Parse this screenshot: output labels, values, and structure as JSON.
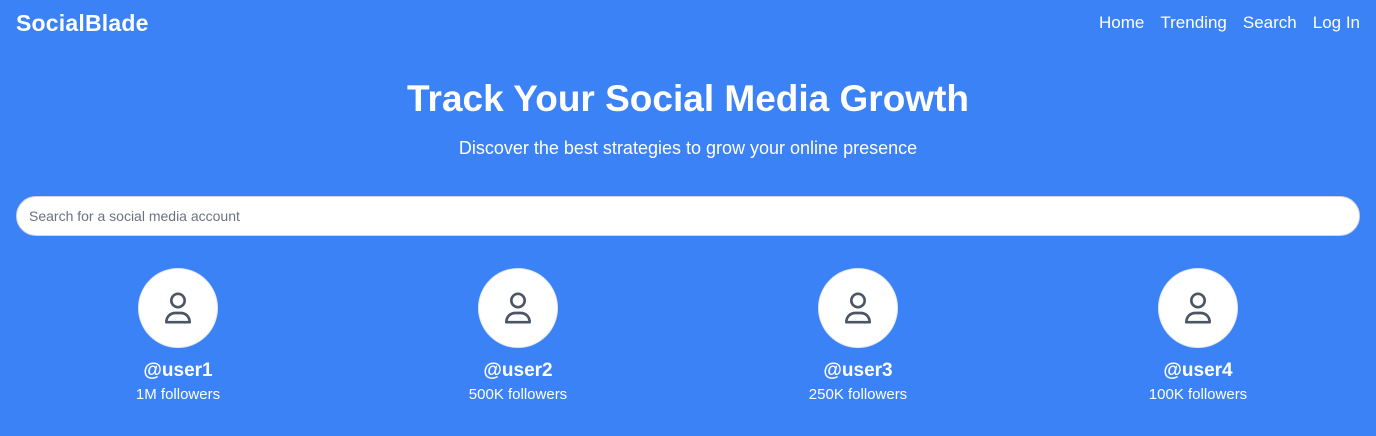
{
  "brand": "SocialBlade",
  "nav": {
    "items": [
      "Home",
      "Trending",
      "Search",
      "Log In"
    ]
  },
  "hero": {
    "title": "Track Your Social Media Growth",
    "subtitle": "Discover the best strategies to grow your online presence"
  },
  "search": {
    "placeholder": "Search for a social media account",
    "value": ""
  },
  "users": [
    {
      "handle": "@user1",
      "followers": "1M followers",
      "icon": "user-icon"
    },
    {
      "handle": "@user2",
      "followers": "500K followers",
      "icon": "user-icon"
    },
    {
      "handle": "@user3",
      "followers": "250K followers",
      "icon": "user-icon"
    },
    {
      "handle": "@user4",
      "followers": "100K followers",
      "icon": "user-icon"
    }
  ],
  "colors": {
    "background": "#3b82f6",
    "text": "#ffffff",
    "avatar_bg": "#ffffff",
    "icon": "#4b5563"
  }
}
